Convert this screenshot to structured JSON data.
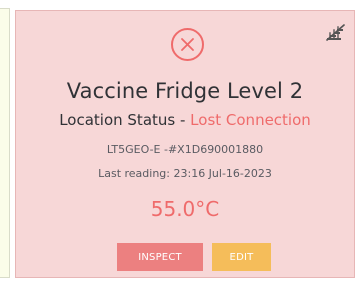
{
  "card": {
    "title": "Vaccine Fridge Level 2",
    "location_status_label": "Location Status - ",
    "location_status_value": "Lost Connection",
    "device_id": "LT5GEO-E -#X1D690001880",
    "last_reading": "Last reading: 23:16 Jul-16-2023",
    "temperature": "55.0°C",
    "buttons": {
      "inspect": "INSPECT",
      "edit": "EDIT"
    }
  },
  "icons": {
    "status": "close-circle-icon",
    "connection": "no-signal-icon"
  },
  "colors": {
    "card_background": "#f7d7d7",
    "alert": "#ef6b6b",
    "inspect_button": "#ec8080",
    "edit_button": "#f5bd5a",
    "left_card": "#fbfde9"
  }
}
